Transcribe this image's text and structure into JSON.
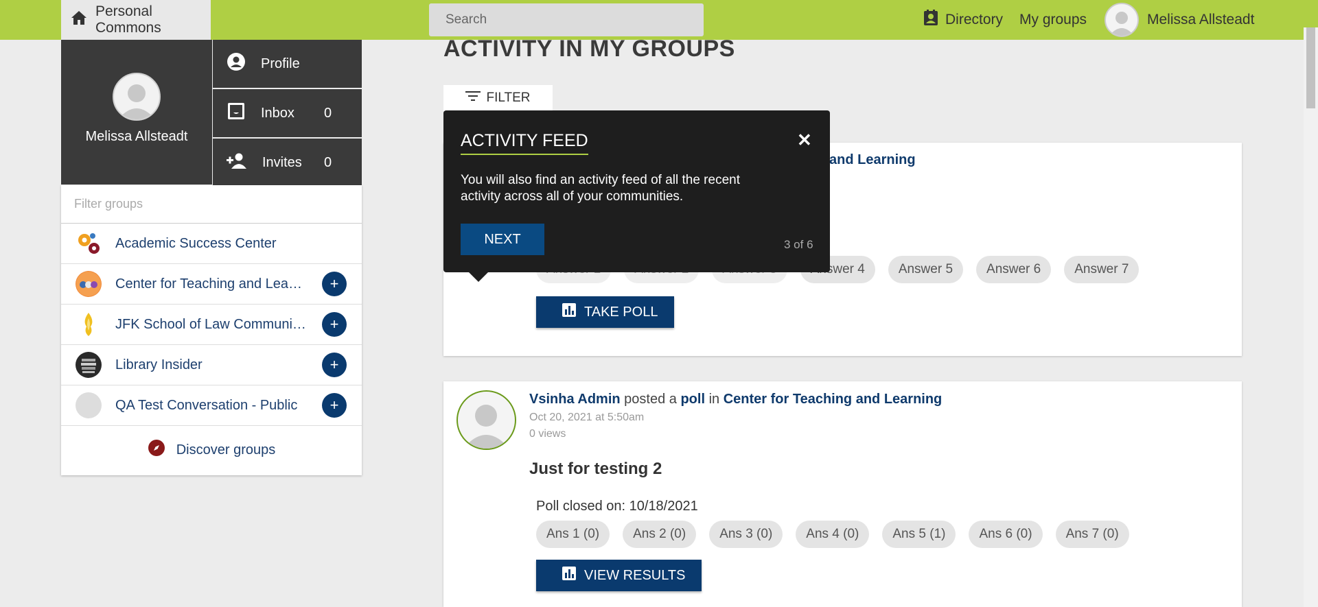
{
  "header": {
    "home_label": "Personal Commons",
    "search_placeholder": "Search",
    "directory_label": "Directory",
    "my_groups_label": "My groups",
    "user_name": "Melissa Allsteadt"
  },
  "profile": {
    "name": "Melissa Allsteadt",
    "menu": [
      {
        "label": "Profile",
        "icon": "account-circle-icon",
        "count": ""
      },
      {
        "label": "Inbox",
        "icon": "inbox-icon",
        "count": "0"
      },
      {
        "label": "Invites",
        "icon": "person-add-icon",
        "count": "0"
      }
    ]
  },
  "groups": {
    "filter_placeholder": "Filter groups",
    "items": [
      {
        "name": "Academic Success Center",
        "joinable": false
      },
      {
        "name": "Center for Teaching and Lea…",
        "joinable": true
      },
      {
        "name": "JFK School of Law Communi…",
        "joinable": true
      },
      {
        "name": "Library Insider",
        "joinable": true
      },
      {
        "name": "QA Test Conversation - Public",
        "joinable": true
      }
    ],
    "discover_label": "Discover groups"
  },
  "main": {
    "heading": "ACTIVITY IN MY GROUPS",
    "filter_label": "FILTER",
    "post1": {
      "group_link": "and Learning",
      "answers": [
        "Answer 4",
        "Answer 5",
        "Answer 6",
        "Answer 7"
      ],
      "button_label": "TAKE POLL"
    },
    "post2": {
      "author": "Vsinha Admin",
      "verb": "posted a",
      "type": "poll",
      "in_word": "in",
      "group": "Center for Teaching and Learning",
      "date": "Oct 20, 2021 at 5:50am",
      "views": "0 views",
      "title": "Just for testing 2",
      "closed": "Poll closed on: 10/18/2021",
      "answers": [
        "Ans 1 (0)",
        "Ans 2 (0)",
        "Ans 3 (0)",
        "Ans 4 (0)",
        "Ans 5 (1)",
        "Ans 6 (0)",
        "Ans 7 (0)"
      ],
      "button_label": "VIEW RESULTS"
    }
  },
  "tooltip": {
    "title": "ACTIVITY FEED",
    "body": "You will also find an activity feed of all the recent activity across all of your communities.",
    "next_label": "NEXT",
    "step": "3 of 6"
  },
  "colors": {
    "topbar": "#afcf44",
    "primary": "#0a3a6e",
    "dark_panel": "#3a3a3a",
    "tooltip_bg": "#1e1e1e"
  }
}
